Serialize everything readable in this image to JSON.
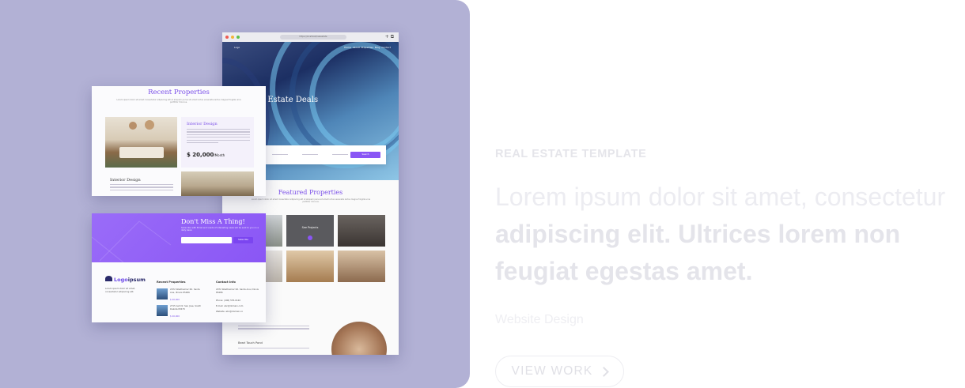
{
  "eyebrow": "REAL ESTATE TEMPLATE",
  "headline": {
    "light_1": "Lorem ipsum dolor sit amet, consectetur ",
    "bold_1": "adipiscing elit. Ultrices lorem non feugiat egestas amet."
  },
  "category": "Website Design",
  "cta": {
    "label": "VIEW WORK",
    "icon": "chevron-right-icon"
  },
  "mockup": {
    "browser": {
      "url": "https://localhost/realestate",
      "nav": [
        "Logo",
        "Home",
        "About",
        "Properties",
        "Blog",
        "Contact"
      ],
      "hero_title": "al Estate Deals",
      "search_button": "Search",
      "featured_title": "Featured Properties",
      "featured_sub": "Lorem ipsum dolor sit amet consectetur adipiscing elit ut aliquam purus sit amet luctus venenatis lectus magna fringilla urna porttitor rhoncus.",
      "tile_label": "See Projects",
      "section_fragment": "es",
      "list_item_1": "Long Beach Palm",
      "list_item_2": "Bearl Touch Pond"
    },
    "recent": {
      "title": "Recent Properties",
      "sub": "Lorem ipsum dolor sit amet consectetur adipiscing elit ut aliquam purus sit amet luctus venenatis lectus magna fringilla urna porttitor rhoncus.",
      "card_title": "Interior Design",
      "read_more": "Read more",
      "price": "$ 20,000",
      "price_unit": "/Month",
      "item_2_title": "Interior Design"
    },
    "newsletter": {
      "title": "Don't Miss A Thing!",
      "sub": "Subscribe with Email and Loads of interesting news will be sent to you on a daily basis",
      "button": "Subscribe",
      "logo_mark": "Logo",
      "logo_text": "ipsum",
      "logo_tagline": "Lorem ipsum dolor sit amet, consectetur adipiscing elit.",
      "col1_head": "Recent Properties",
      "col1_item1": "2972 Westheimer Rd. Santa Ana, Illinois 85486",
      "col1_price1": "$ 20,000",
      "col1_item2": "2715 Ash Dr. San Jose, South Dakota 83475",
      "col1_price2": "$ 20,000",
      "col2_head": "Contact Info",
      "col2_address": "2972 Westheimer Rd. Santa Ana, Illinois 85486",
      "col2_phone": "Phone: (406) 555-0120",
      "col2_email": "E-mail: abc@domain.com",
      "col2_web": "Website: abc@domain.co"
    }
  },
  "colors": {
    "card_bg": "#b2b1d5",
    "accent": "#8a56f5",
    "muted_text": "#ececf1"
  }
}
